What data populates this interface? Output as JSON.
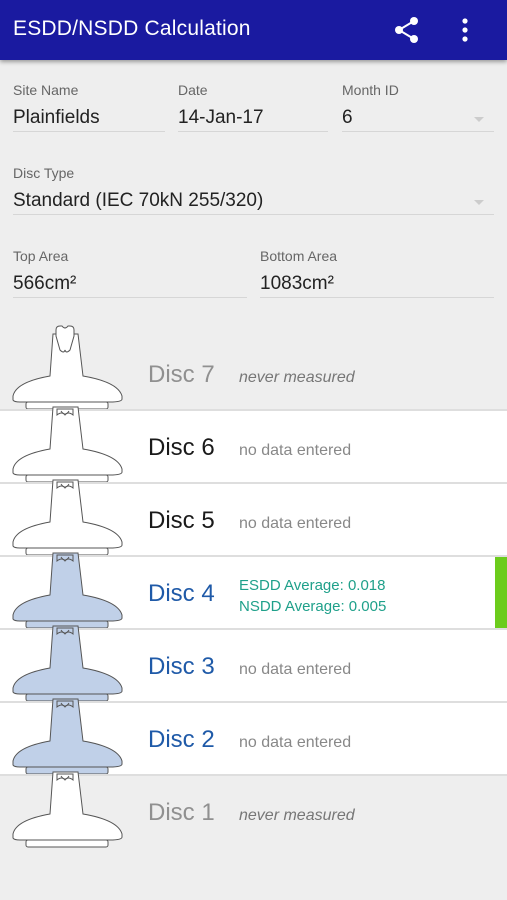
{
  "appbar": {
    "title": "ESDD/NSDD Calculation",
    "share_icon": "share-icon",
    "more_icon": "more-vert-icon",
    "color": "#1a1aa0"
  },
  "form": {
    "site_name": {
      "label": "Site Name",
      "value": "Plainfields"
    },
    "date": {
      "label": "Date",
      "value": "14-Jan-17"
    },
    "month_id": {
      "label": "Month ID",
      "value": "6"
    },
    "disc_type": {
      "label": "Disc Type",
      "value": "Standard (IEC 70kN 255/320)"
    },
    "top_area": {
      "label": "Top Area",
      "value": "566cm²"
    },
    "bottom_area": {
      "label": "Bottom Area",
      "value": "1083cm²"
    }
  },
  "discs": [
    {
      "name": "Disc 7",
      "status": "never measured",
      "state": "never",
      "filled": false
    },
    {
      "name": "Disc 6",
      "status": "no data entered",
      "state": "empty",
      "filled": false
    },
    {
      "name": "Disc 5",
      "status": "no data entered",
      "state": "empty",
      "filled": false
    },
    {
      "name": "Disc 4",
      "esdd": "ESDD Average: 0.018",
      "nsdd": "NSDD Average: 0.005",
      "state": "measured",
      "filled": true
    },
    {
      "name": "Disc 3",
      "status": "no data entered",
      "state": "empty",
      "filled": true
    },
    {
      "name": "Disc 2",
      "status": "no data entered",
      "state": "empty",
      "filled": true
    },
    {
      "name": "Disc 1",
      "status": "never measured",
      "state": "never",
      "filled": false
    }
  ],
  "colors": {
    "selected_text": "#1f5aa8",
    "stats_text": "#1fa08a",
    "measured_marker": "#6ccc1c",
    "insulator_fill": "#c0d0e8"
  }
}
